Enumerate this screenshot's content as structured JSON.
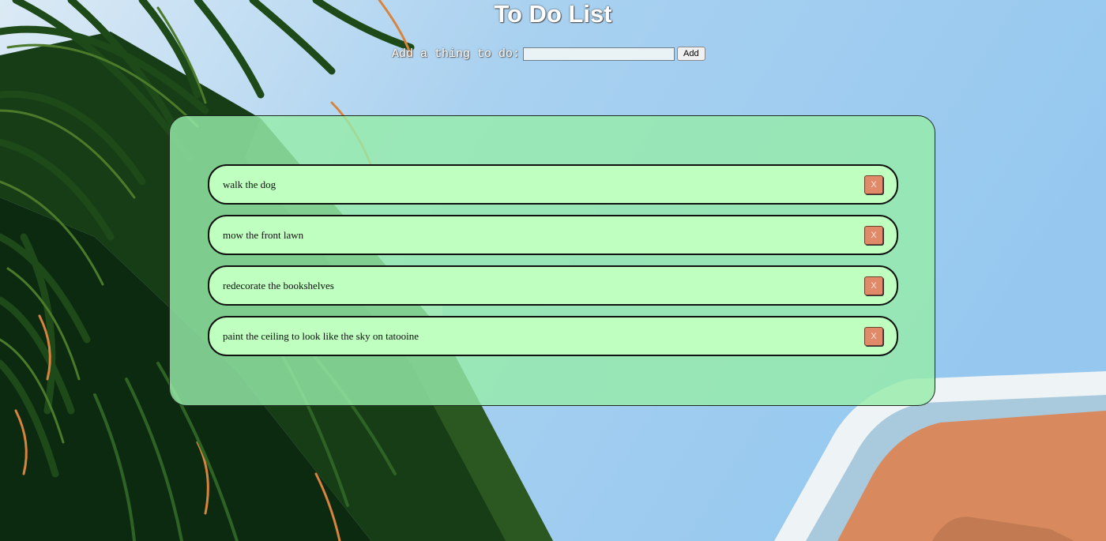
{
  "page": {
    "title": "To Do List"
  },
  "add_form": {
    "label": "Add a thing to do:",
    "input_value": "",
    "input_placeholder": "",
    "button_label": "Add"
  },
  "todos": [
    {
      "text": "walk the dog",
      "delete_label": "X"
    },
    {
      "text": "mow the front lawn",
      "delete_label": "X"
    },
    {
      "text": "redecorate the bookshelves",
      "delete_label": "X"
    },
    {
      "text": "paint the ceiling to look like the sky on tatooine",
      "delete_label": "X"
    }
  ],
  "colors": {
    "sky": "#9dcaee",
    "panel": "#96ebaa",
    "item": "#bfffc0",
    "delete_button": "#e08a6a",
    "palm_dark": "#0c2a10",
    "building": "#d88a5e"
  },
  "background": {
    "scene": "palm-tree-against-sky"
  }
}
